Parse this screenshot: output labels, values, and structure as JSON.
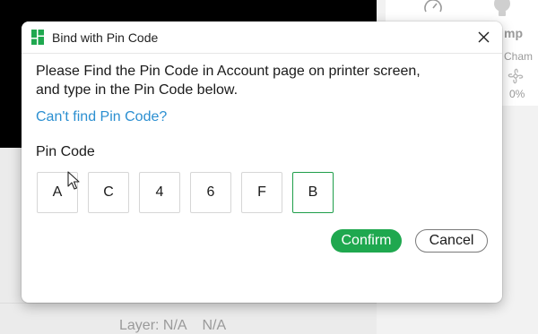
{
  "background": {
    "temp_label": "mp",
    "chamber_label": "Cham",
    "chamber_percent": "0%",
    "layer_text": "Layer: N/A",
    "layer_value": "N/A"
  },
  "dialog": {
    "title": "Bind with Pin Code",
    "close_symbol": "✕",
    "instruction": "Please Find the Pin Code in Account page on printer screen,\n and type in the Pin Code below.",
    "help_link": "Can't find Pin Code?",
    "pin_label": "Pin Code",
    "pin_digits": [
      "A",
      "C",
      "4",
      "6",
      "F",
      "B"
    ],
    "confirm_label": "Confirm",
    "cancel_label": "Cancel"
  },
  "colors": {
    "accent": "#1fa84f",
    "link": "#2b8fd1",
    "active_border": "#1f9e4a"
  }
}
